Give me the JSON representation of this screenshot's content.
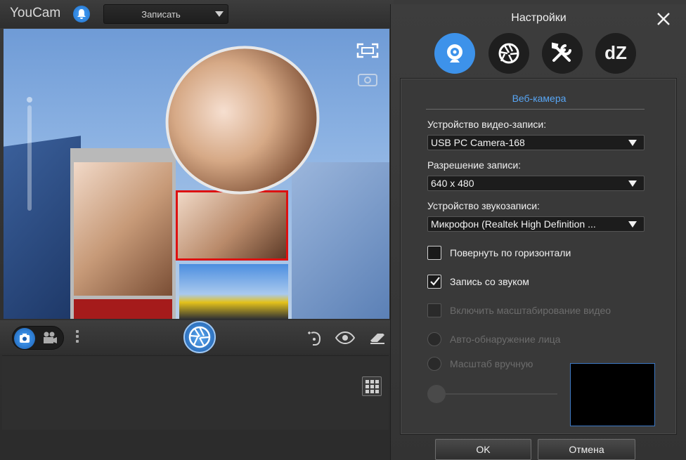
{
  "app": {
    "title": "YouCam",
    "mode_select": "Записать",
    "icons": [
      "bell-icon",
      "fullscreen-icon",
      "camera-icon",
      "video-icon",
      "shutter-icon",
      "face-icon",
      "eye-icon",
      "eraser-icon",
      "grid-icon"
    ]
  },
  "dialog": {
    "title": "Настройки",
    "tabs": [
      {
        "name": "webcam",
        "icon": "webcam-icon",
        "active": true
      },
      {
        "name": "capture",
        "icon": "aperture-icon",
        "active": false
      },
      {
        "name": "tools",
        "icon": "tools-icon",
        "active": false
      },
      {
        "name": "dz",
        "label": "dZ",
        "active": false
      }
    ],
    "section_title": "Веб-камера",
    "video_device_label": "Устройство видео-записи:",
    "video_device_value": "USB PC Camera-168",
    "resolution_label": "Разрешение записи:",
    "resolution_value": "640 x 480",
    "audio_device_label": "Устройство звукозаписи:",
    "audio_device_value": "Микрофон (Realtek High Definition ...",
    "flip_horizontal": {
      "label": "Повернуть по горизонтали",
      "checked": false
    },
    "record_audio": {
      "label": "Запись со звуком",
      "checked": true
    },
    "enable_zoom": {
      "label": "Включить масштабирование видео",
      "checked": false,
      "disabled": true
    },
    "auto_face": {
      "label": "Авто-обнаружение лица",
      "disabled": true
    },
    "manual_zoom": {
      "label": "Масштаб вручную",
      "disabled": true
    },
    "ok_label": "OK",
    "cancel_label": "Отмена",
    "accent_color": "#3d92ea"
  }
}
